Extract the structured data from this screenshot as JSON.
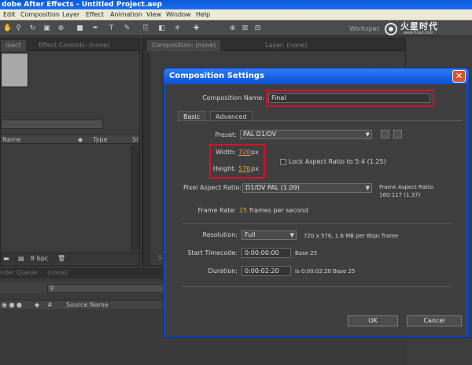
{
  "app": {
    "title": "dobe After Effects - Untitled Project.aep",
    "menu": [
      "Edit",
      "Composition",
      "Layer",
      "Effect",
      "Animation",
      "View",
      "Window",
      "Help"
    ],
    "workspace_label": "Workspac",
    "watermark": {
      "text": "火星时代",
      "url": "www.hxsd.com"
    }
  },
  "project_panel": {
    "tabs": [
      "oject",
      "Effect Controls: (none)"
    ],
    "columns": [
      "Name",
      "Type",
      "Si"
    ],
    "bpc_label": "8 bpc"
  },
  "composition_panel": {
    "tab": "Composition: (none)",
    "layer_tab": "Layer: (none)",
    "bottom_tab": "S"
  },
  "bottom_panel": {
    "tabs": [
      "nder Queue",
      "(none)"
    ],
    "search_icon": "magnifier",
    "column": "Source Name"
  },
  "dialog": {
    "title": "Composition Settings",
    "close_symbol": "✕",
    "name_label": "Composition Name:",
    "name_value": "Final",
    "tabs": [
      "Basic",
      "Advanced"
    ],
    "preset_label": "Preset:",
    "preset_value": "PAL D1/DV",
    "width_label": "Width:",
    "width_value": "720",
    "height_label": "Height:",
    "height_value": "576",
    "px": "px",
    "lock_label": "Lock Aspect Ratio to 5:4 (1.25)",
    "pixel_aspect_label": "Pixel Aspect Ratio:",
    "pixel_aspect_value": "D1/DV PAL (1.09)",
    "frame_aspect_label": "Frame Aspect Ratio:",
    "frame_aspect_value": "160:117 (1.37)",
    "frame_rate_label": "Frame Rate:",
    "frame_rate_value": "25",
    "frame_rate_unit": "frames per second",
    "resolution_label": "Resolution:",
    "resolution_value": "Full",
    "resolution_info": "720 x 576, 1.6 MB per 8bpc frame",
    "start_tc_label": "Start Timecode:",
    "start_tc_value": "0:00:00:00",
    "start_tc_base": "Base 25",
    "duration_label": "Duration:",
    "duration_value": "0:00:02:20",
    "duration_info": "is 0:00:02:20  Base 25",
    "ok_label": "OK",
    "cancel_label": "Cancel"
  },
  "colors": {
    "dialog_frame": "#0846d8",
    "highlight": "#d8102c",
    "value_orange": "#e0a63c",
    "close_button": "#d9532b"
  }
}
